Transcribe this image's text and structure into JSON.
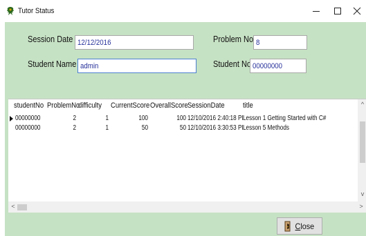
{
  "window": {
    "title": "Tutor Status",
    "colors": {
      "client_bg": "#c6e2c4",
      "input_text": "#26309a"
    }
  },
  "controls": {
    "minimize_icon": "minimize-icon",
    "maximize_icon": "maximize-icon",
    "close_icon": "close-icon"
  },
  "form": {
    "session_date_label": "Session Date",
    "session_date_value": "12/12/2016",
    "problem_no_label": "Problem No",
    "problem_no_value": "8",
    "student_name_label": "Student Name",
    "student_name_value": "admin",
    "student_no_label": "Student No",
    "student_no_value": "00000000"
  },
  "table": {
    "columns": [
      "studentNo",
      "ProblemNo",
      "difficulty",
      "CurrentScore",
      "OverallScore",
      "SessionDate",
      "title"
    ],
    "rows": [
      [
        "00000000",
        "2",
        "1",
        "100",
        "100",
        "12/10/2016 2:40:18 PI",
        "Lesson 1 Getting Started with C#"
      ],
      [
        "00000000",
        "2",
        "1",
        "50",
        "50",
        "12/10/2016 3:30:53 PI",
        "Lesson 5 Methods"
      ]
    ],
    "scroll_up": "^",
    "scroll_down": "v",
    "scroll_left": "<",
    "scroll_right": ">"
  },
  "buttons": {
    "close_label": "Close"
  }
}
